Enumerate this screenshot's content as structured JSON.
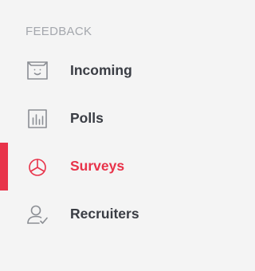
{
  "sidebar": {
    "section_title": "FEEDBACK",
    "accent_color": "#e8334a",
    "text_color": "#3a3d44",
    "icon_color": "#8b8e94",
    "items": [
      {
        "label": "Incoming",
        "icon": "inbox-face-icon",
        "active": false
      },
      {
        "label": "Polls",
        "icon": "bar-chart-icon",
        "active": false
      },
      {
        "label": "Surveys",
        "icon": "pie-chart-icon",
        "active": true
      },
      {
        "label": "Recruiters",
        "icon": "user-check-icon",
        "active": false
      }
    ]
  }
}
